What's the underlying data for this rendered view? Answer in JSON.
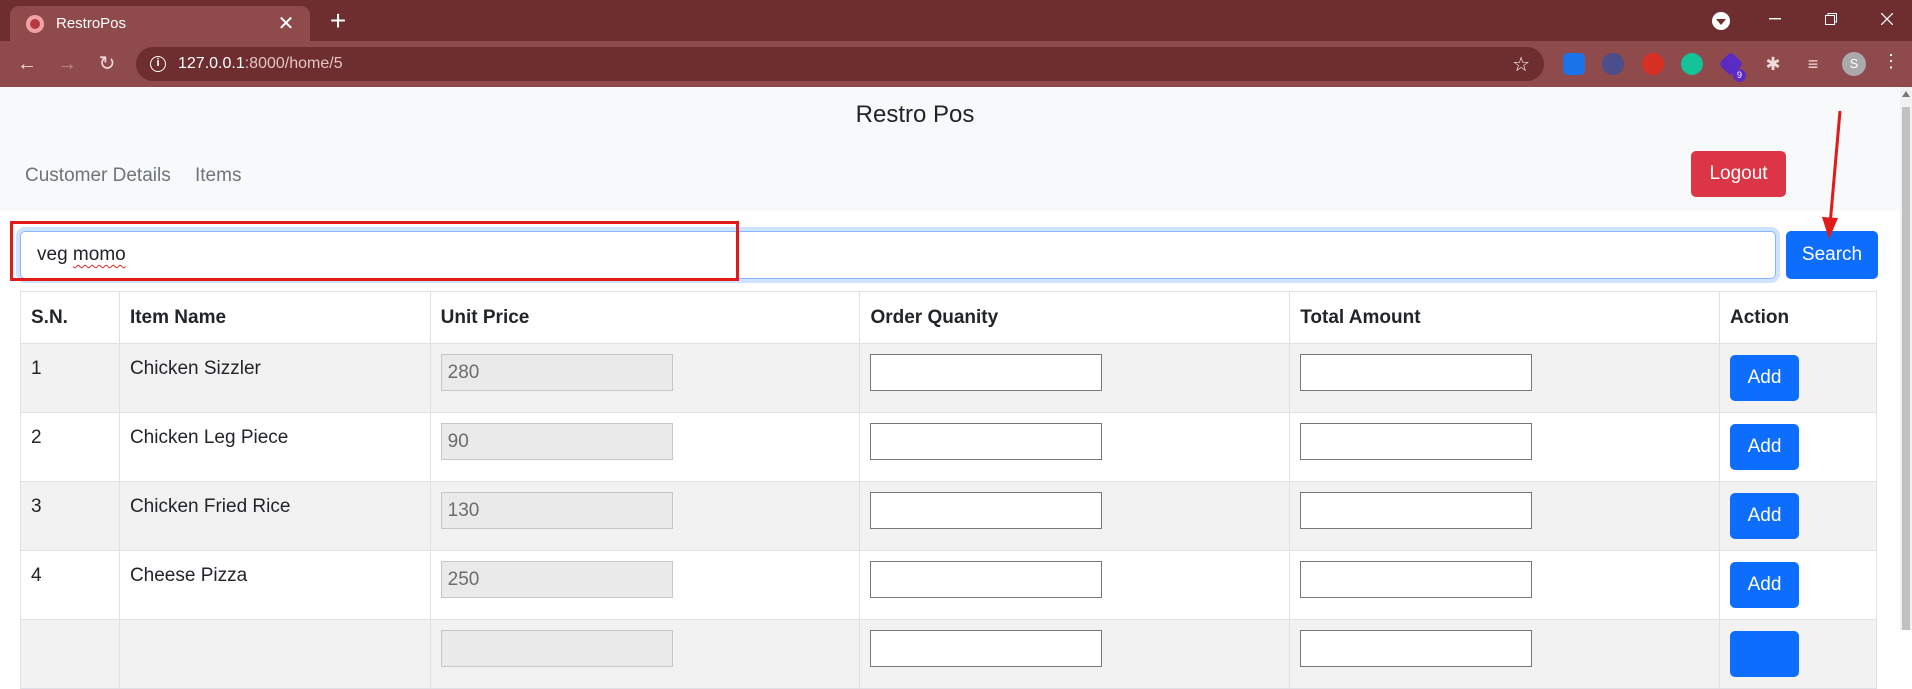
{
  "browser": {
    "tab_title": "RestroPos",
    "tab_close": "✕",
    "new_tab": "+",
    "url_host": "127.0.0.1",
    "url_path": ":8000/home/5",
    "profile_initial": "S",
    "extension_badge": "9"
  },
  "navbar": {
    "brand": "Restro Pos",
    "links": [
      "Customer Details",
      "Items"
    ],
    "logout_label": "Logout"
  },
  "search": {
    "value_plain": "veg ",
    "value_misspelled": "momo",
    "button_label": "Search"
  },
  "table": {
    "headers": [
      "S.N.",
      "Item Name",
      "Unit Price",
      "Order Quanity",
      "Total Amount",
      "Action"
    ],
    "rows": [
      {
        "sn": "1",
        "name": "Chicken Sizzler",
        "price": "280",
        "action": "Add"
      },
      {
        "sn": "2",
        "name": "Chicken Leg Piece",
        "price": "90",
        "action": "Add"
      },
      {
        "sn": "3",
        "name": "Chicken Fried Rice",
        "price": "130",
        "action": "Add"
      },
      {
        "sn": "4",
        "name": "Cheese Pizza",
        "price": "250",
        "action": "Add"
      }
    ]
  },
  "colors": {
    "chrome_dark": "#6e2d2f",
    "chrome_light": "#8f4a4c",
    "primary": "#0d6efd",
    "danger": "#dc3545",
    "annotation": "#e11a1a"
  }
}
